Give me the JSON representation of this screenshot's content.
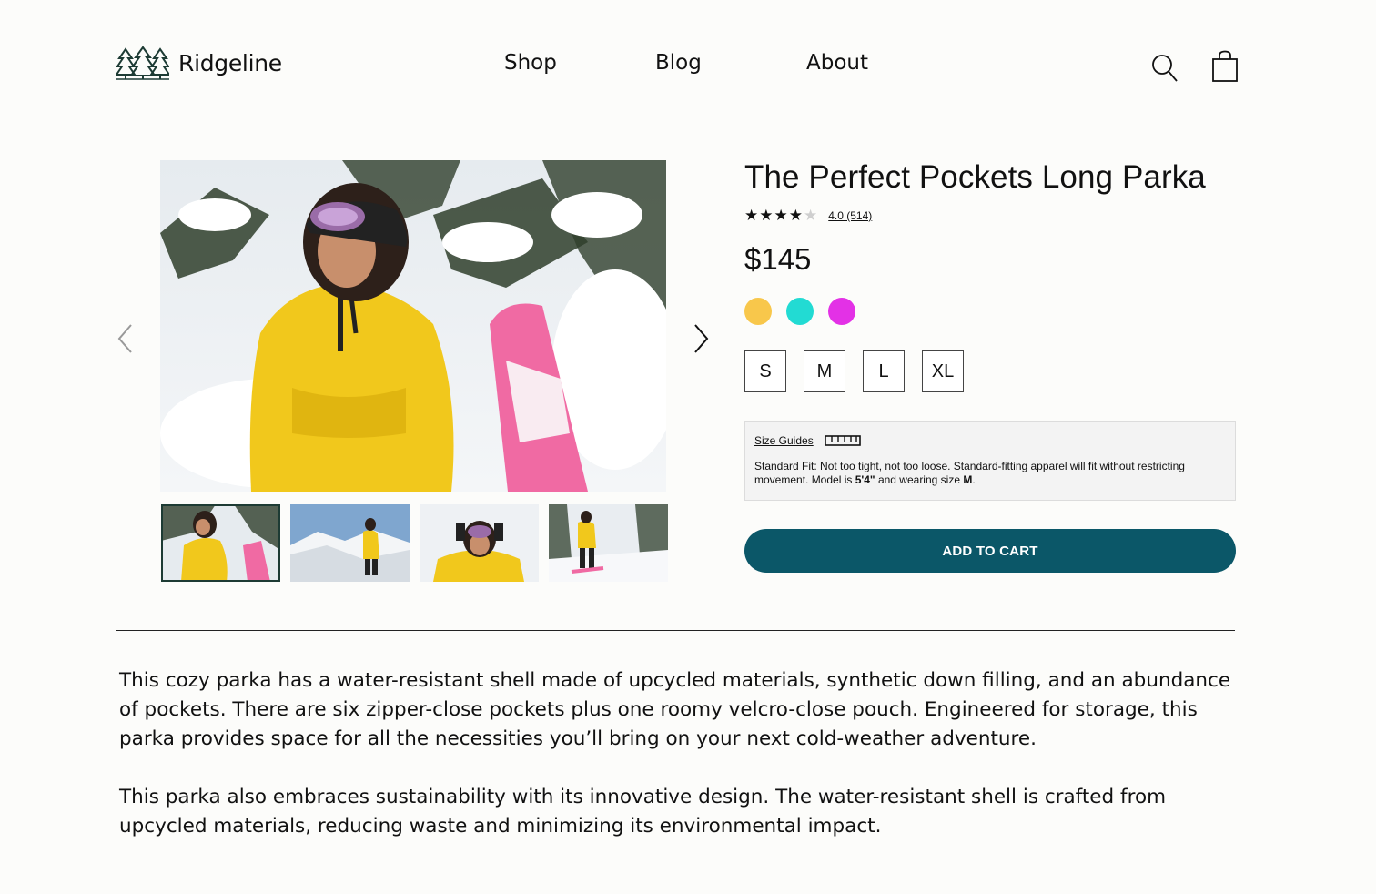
{
  "brand": {
    "name": "Ridgeline",
    "logo_icon": "pine-trees-icon",
    "logo_color": "#1d3b34"
  },
  "nav": {
    "items": [
      "Shop",
      "Blog",
      "About"
    ]
  },
  "header_icons": [
    "search-icon",
    "shopping-bag-icon"
  ],
  "gallery": {
    "prev_icon": "chevron-left-icon",
    "next_icon": "chevron-right-icon",
    "thumbnail_count": 4,
    "active_thumbnail": 0
  },
  "product": {
    "title": "The Perfect Pockets Long Parka",
    "rating": 4.0,
    "rating_max": 5,
    "rating_text": "4.0 (514)",
    "price": "$145",
    "colors": [
      "#f8c74b",
      "#22dbd3",
      "#e331e6"
    ],
    "sizes": [
      "S",
      "M",
      "L",
      "XL"
    ],
    "size_guide": {
      "link": "Size Guides",
      "icon": "ruler-icon",
      "fit_text_1": "Standard Fit: Not too tight, not too loose. Standard-fitting apparel will fit without restricting movement. Model is ",
      "model_height": "5'4\"",
      "fit_text_2": " and wearing size ",
      "model_size": "M",
      "fit_text_3": "."
    },
    "add_to_cart": "ADD TO CART",
    "button_color": "#0b5768"
  },
  "description": {
    "paragraphs": [
      "This cozy parka has a water-resistant shell made of upcycled materials, synthetic down filling, and an abundance of pockets. There are six zipper-close pockets plus one roomy velcro-close pouch. Engineered for storage, this parka provides space for all the necessities you’ll bring on your next cold-weather adventure.",
      "This parka also embraces sustainability with its innovative design. The water-resistant shell is crafted from upcycled materials, reducing waste and minimizing its environmental impact."
    ]
  }
}
